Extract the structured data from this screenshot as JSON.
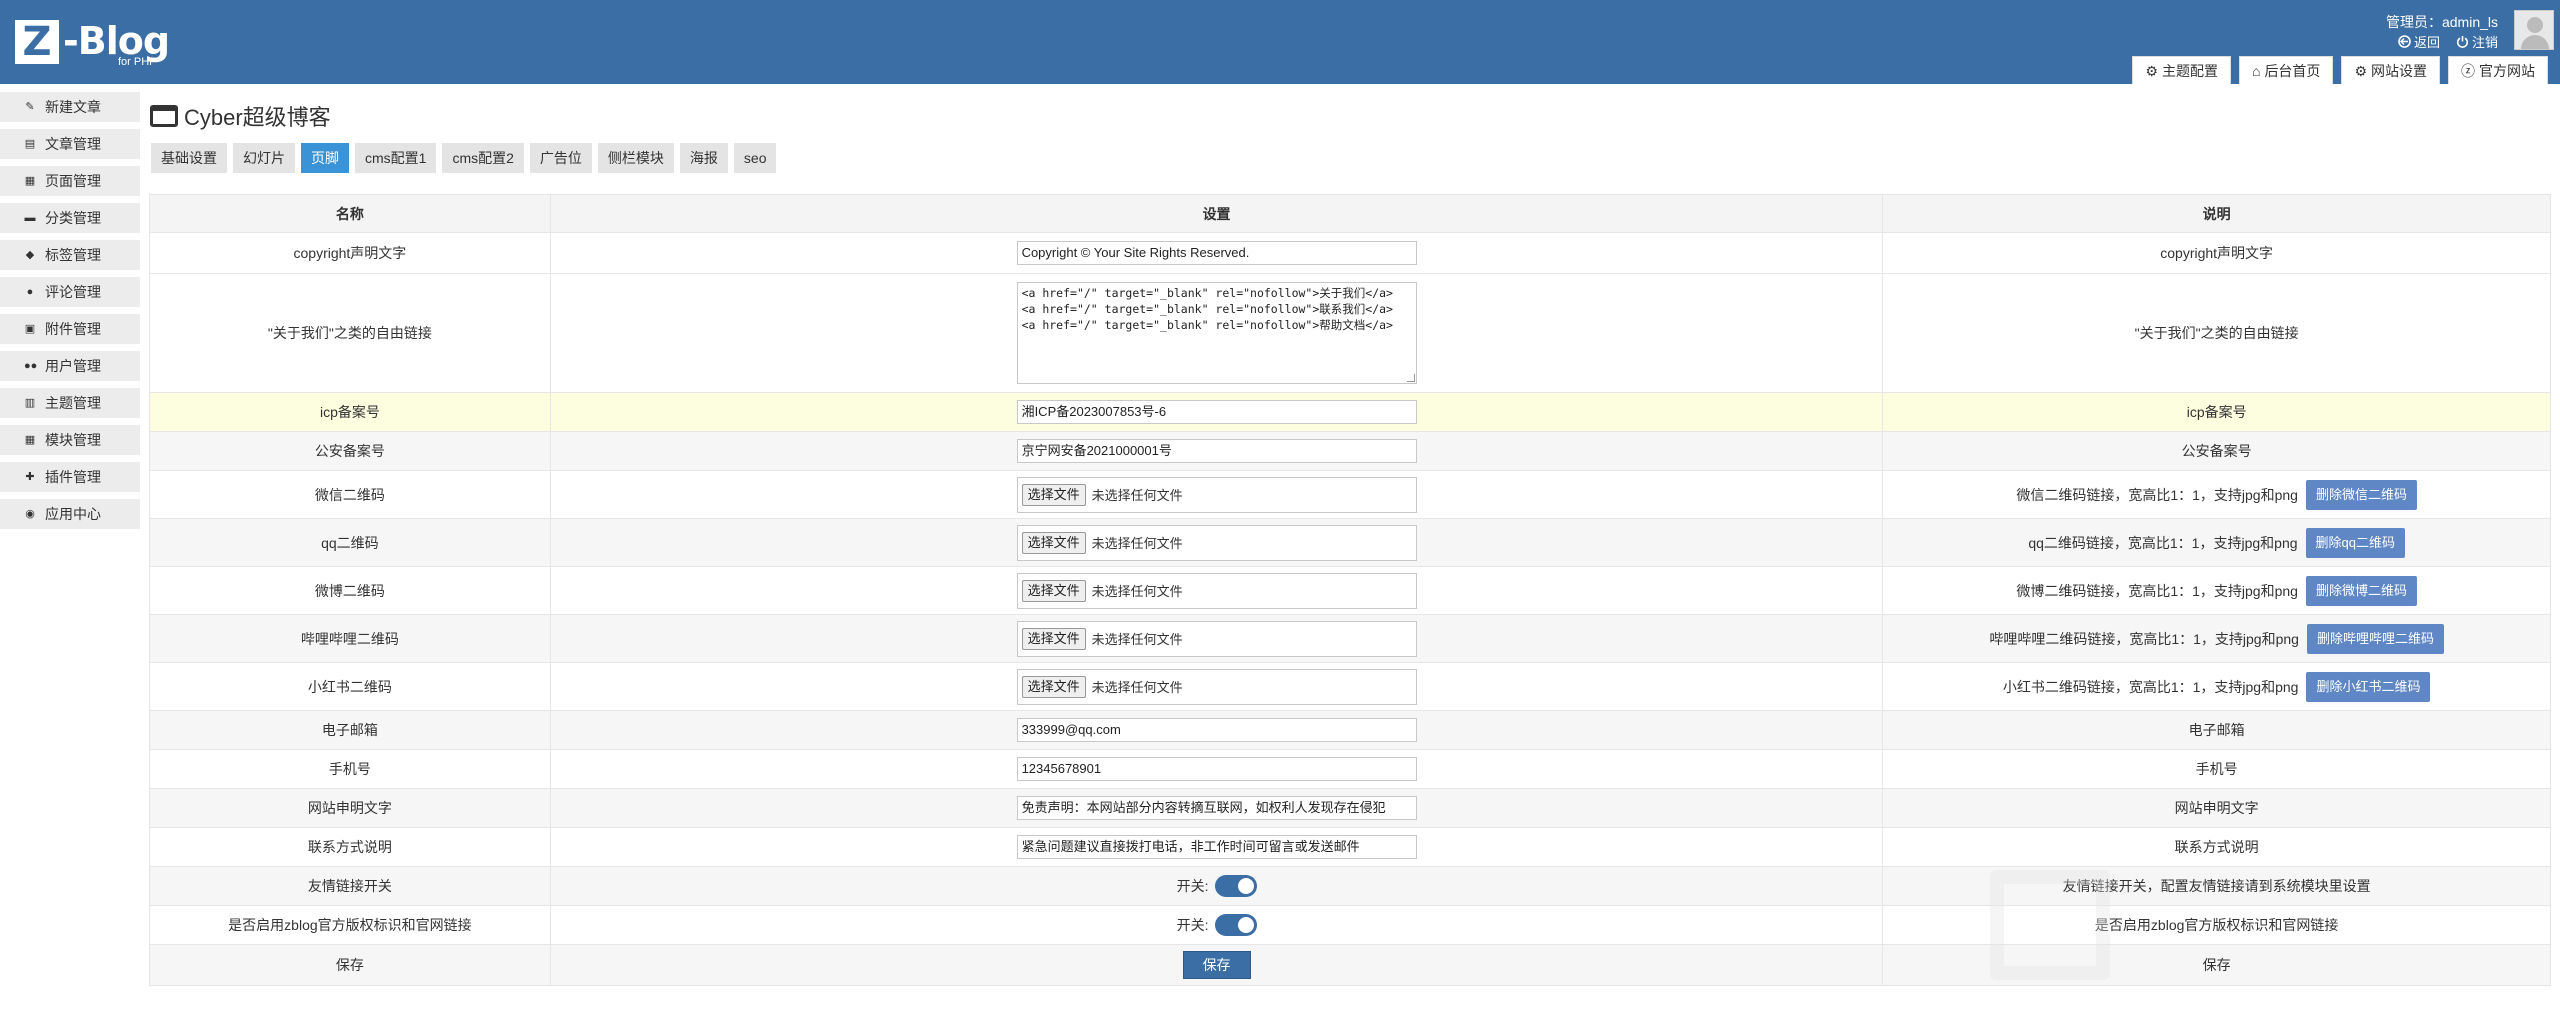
{
  "header": {
    "logo_letter": "Z",
    "logo_text": "-Blog",
    "logo_sub": "for PHP",
    "admin_label": "管理员：admin_ls",
    "back_label": "返回",
    "logout_label": "注销",
    "tabs": [
      {
        "label": "主题配置",
        "icon": "gear-icon"
      },
      {
        "label": "后台首页",
        "icon": "home-icon"
      },
      {
        "label": "网站设置",
        "icon": "gear-icon"
      },
      {
        "label": "官方网站",
        "icon": "zblog-icon"
      }
    ]
  },
  "sidebar": {
    "items": [
      {
        "label": "新建文章",
        "icon": "edit-icon"
      },
      {
        "label": "文章管理",
        "icon": "article-icon"
      },
      {
        "label": "页面管理",
        "icon": "page-icon"
      },
      {
        "label": "分类管理",
        "icon": "folder-icon"
      },
      {
        "label": "标签管理",
        "icon": "tag-icon"
      },
      {
        "label": "评论管理",
        "icon": "comment-icon"
      },
      {
        "label": "附件管理",
        "icon": "attachment-icon"
      },
      {
        "label": "用户管理",
        "icon": "users-icon"
      },
      {
        "label": "主题管理",
        "icon": "theme-icon"
      },
      {
        "label": "模块管理",
        "icon": "module-icon"
      },
      {
        "label": "插件管理",
        "icon": "plugin-icon"
      },
      {
        "label": "应用中心",
        "icon": "app-center-icon"
      }
    ]
  },
  "page": {
    "title": "Cyber超级博客",
    "tabs": [
      "基础设置",
      "幻灯片",
      "页脚",
      "cms配置1",
      "cms配置2",
      "广告位",
      "侧栏模块",
      "海报",
      "seo"
    ],
    "active_tab": "页脚"
  },
  "table": {
    "headers": {
      "name": "名称",
      "setting": "设置",
      "desc": "说明"
    },
    "rows": [
      {
        "name": "copyright声明文字",
        "value": "Copyright © Your Site Rights Reserved.",
        "desc": "copyright声明文字"
      },
      {
        "name": "\"关于我们\"之类的自由链接",
        "value": "<a href=\"/\" target=\"_blank\" rel=\"nofollow\">关于我们</a>\n<a href=\"/\" target=\"_blank\" rel=\"nofollow\">联系我们</a>\n<a href=\"/\" target=\"_blank\" rel=\"nofollow\">帮助文档</a>",
        "desc": "\"关于我们\"之类的自由链接"
      },
      {
        "name": "icp备案号",
        "value": "湘ICP备2023007853号-6",
        "desc": "icp备案号"
      },
      {
        "name": "公安备案号",
        "value": "京宁网安备2021000001号",
        "desc": "公安备案号"
      },
      {
        "name": "微信二维码",
        "file_btn": "选择文件",
        "file_txt": "未选择任何文件",
        "desc": "微信二维码链接，宽高比1：1，支持jpg和png",
        "del": "删除微信二维码"
      },
      {
        "name": "qq二维码",
        "file_btn": "选择文件",
        "file_txt": "未选择任何文件",
        "desc": "qq二维码链接，宽高比1：1，支持jpg和png",
        "del": "删除qq二维码"
      },
      {
        "name": "微博二维码",
        "file_btn": "选择文件",
        "file_txt": "未选择任何文件",
        "desc": "微博二维码链接，宽高比1：1，支持jpg和png",
        "del": "删除微博二维码"
      },
      {
        "name": "哔哩哔哩二维码",
        "file_btn": "选择文件",
        "file_txt": "未选择任何文件",
        "desc": "哔哩哔哩二维码链接，宽高比1：1，支持jpg和png",
        "del": "删除哔哩哔哩二维码"
      },
      {
        "name": "小红书二维码",
        "file_btn": "选择文件",
        "file_txt": "未选择任何文件",
        "desc": "小红书二维码链接，宽高比1：1，支持jpg和png",
        "del": "删除小红书二维码"
      },
      {
        "name": "电子邮箱",
        "value": "333999@qq.com",
        "desc": "电子邮箱"
      },
      {
        "name": "手机号",
        "value": "12345678901",
        "desc": "手机号"
      },
      {
        "name": "网站申明文字",
        "value": "免责声明：本网站部分内容转摘互联网，如权利人发现存在侵犯",
        "desc": "网站申明文字"
      },
      {
        "name": "联系方式说明",
        "value": "紧急问题建议直接拨打电话，非工作时间可留言或发送邮件",
        "desc": "联系方式说明"
      },
      {
        "name": "友情链接开关",
        "switch_label": "开关:",
        "desc": "友情链接开关，配置友情链接请到系统模块里设置"
      },
      {
        "name": "是否启用zblog官方版权标识和官网链接",
        "switch_label": "开关:",
        "desc": "是否启用zblog官方版权标识和官网链接"
      },
      {
        "name": "保存",
        "save_label": "保存",
        "desc": "保存"
      }
    ]
  },
  "colors": {
    "header_bg": "#3a6ea5",
    "active_tab": "#3a93d6",
    "delete_button": "#5f87c6",
    "highlight_row": "#fdfde0"
  }
}
